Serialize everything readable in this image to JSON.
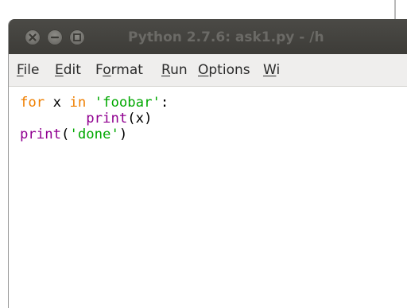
{
  "window": {
    "title": "Python 2.7.6: ask1.py - /h"
  },
  "menu": [
    {
      "underline": "F",
      "rest": "ile"
    },
    {
      "underline": "E",
      "rest": "dit"
    },
    {
      "pre": "F",
      "underline": "o",
      "rest": "rmat"
    },
    {
      "underline": "R",
      "rest": "un"
    },
    {
      "underline": "O",
      "rest": "ptions"
    },
    {
      "underline": "W",
      "rest": "i"
    }
  ],
  "editor": {
    "lines": [
      [
        "for",
        " x ",
        "in",
        " ",
        "'foobar'",
        ":"
      ],
      [
        "        ",
        "print",
        "(x)"
      ],
      [
        "print",
        "(",
        "'done'",
        ")"
      ]
    ]
  },
  "colors": {
    "keyword": "#ef7f00",
    "builtin": "#900090",
    "string": "#00a800",
    "titlebar": "#3d3c38"
  }
}
